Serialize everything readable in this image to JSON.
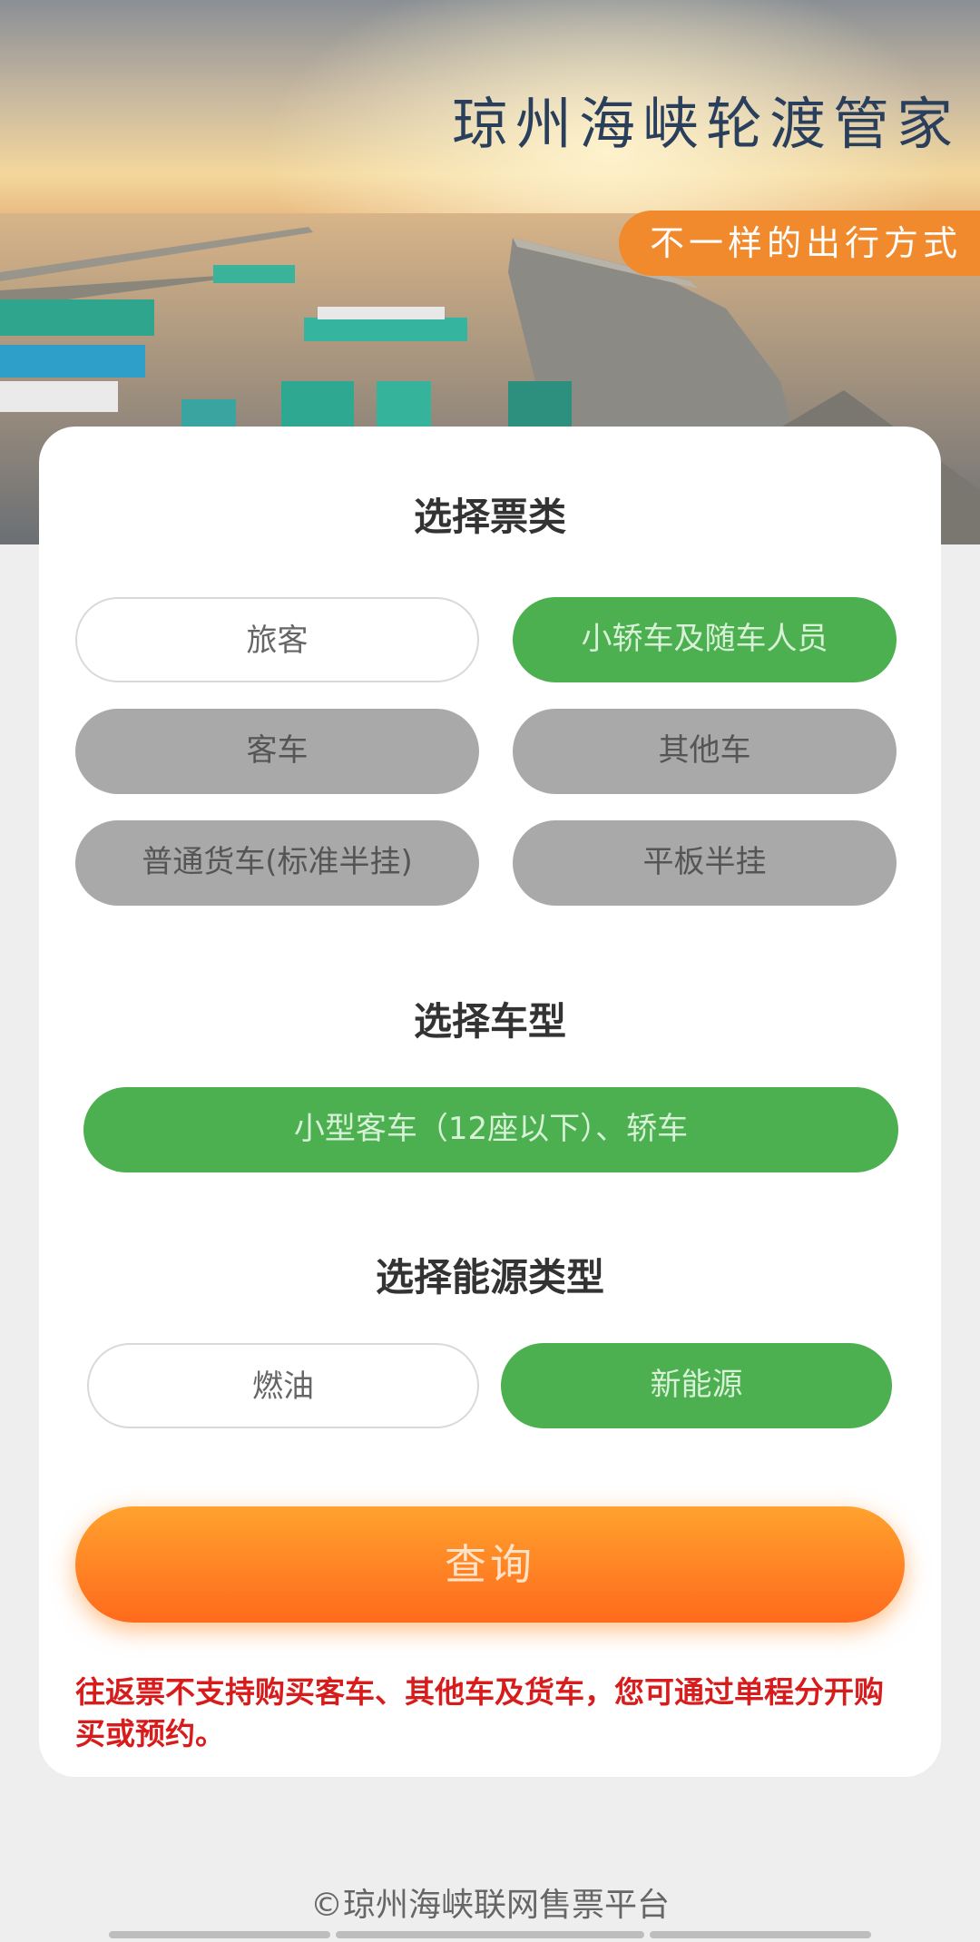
{
  "hero": {
    "title": "琼州海峡轮渡管家",
    "badge": "不一样的出行方式"
  },
  "ticket_type": {
    "title": "选择票类",
    "options": [
      {
        "label": "旅客",
        "state": "outline"
      },
      {
        "label": "小轿车及随车人员",
        "state": "selected"
      },
      {
        "label": "客车",
        "state": "disabled"
      },
      {
        "label": "其他车",
        "state": "disabled"
      },
      {
        "label": "普通货车(标准半挂)",
        "state": "disabled"
      },
      {
        "label": "平板半挂",
        "state": "disabled"
      }
    ]
  },
  "vehicle_type": {
    "title": "选择车型",
    "selected": "小型客车（12座以下）、轿车"
  },
  "energy_type": {
    "title": "选择能源类型",
    "options": [
      {
        "label": "燃油",
        "state": "outline"
      },
      {
        "label": "新能源",
        "state": "selected"
      }
    ]
  },
  "query_button": "查询",
  "notice": "往返票不支持购买客车、其他车及货车，您可通过单程分开购买或预约。",
  "footer": "©琼州海峡联网售票平台",
  "colors": {
    "selected": "#4caf50",
    "disabled": "#a9a9a9",
    "query": "#ff8a25",
    "notice": "#d81b1b",
    "badge": "#f08a2c"
  }
}
